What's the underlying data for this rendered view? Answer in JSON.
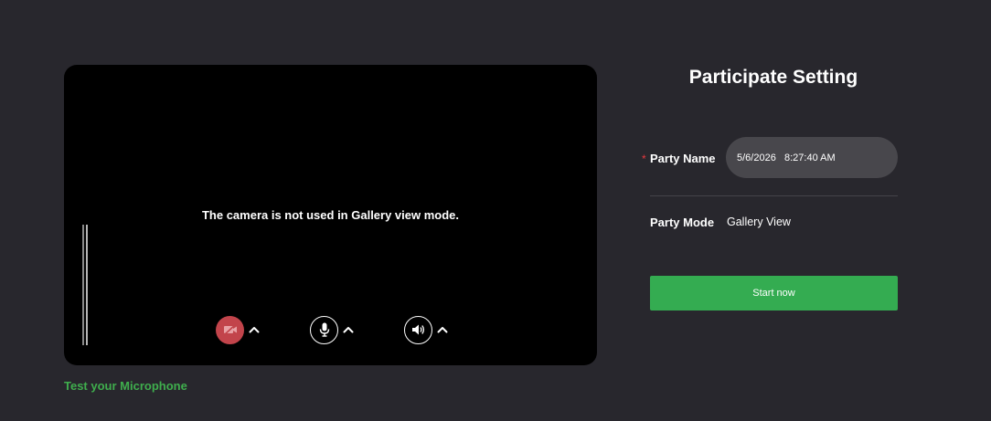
{
  "preview": {
    "message": "The camera is not used in Gallery view mode.",
    "camera_state": "off",
    "controls": {
      "camera_icon": "video-off-icon",
      "mic_icon": "microphone-icon",
      "speaker_icon": "speaker-icon",
      "chevron_icon": "chevron-up-icon"
    }
  },
  "test_mic_link": "Test your Microphone",
  "settings": {
    "title": "Participate Setting",
    "party_name_label": "Party Name",
    "party_name_value": "5/6/2026   8:27:40 AM",
    "required_marker": "*",
    "party_mode_label": "Party Mode",
    "party_mode_value": "Gallery View",
    "start_button_label": "Start now"
  },
  "colors": {
    "background": "#28272d",
    "preview_bg": "#000000",
    "accent_green": "#34ac51",
    "link_green": "#3fae4d",
    "camera_off_red": "#c2444b",
    "required_red": "#e8393f",
    "input_bg": "#48474c"
  }
}
